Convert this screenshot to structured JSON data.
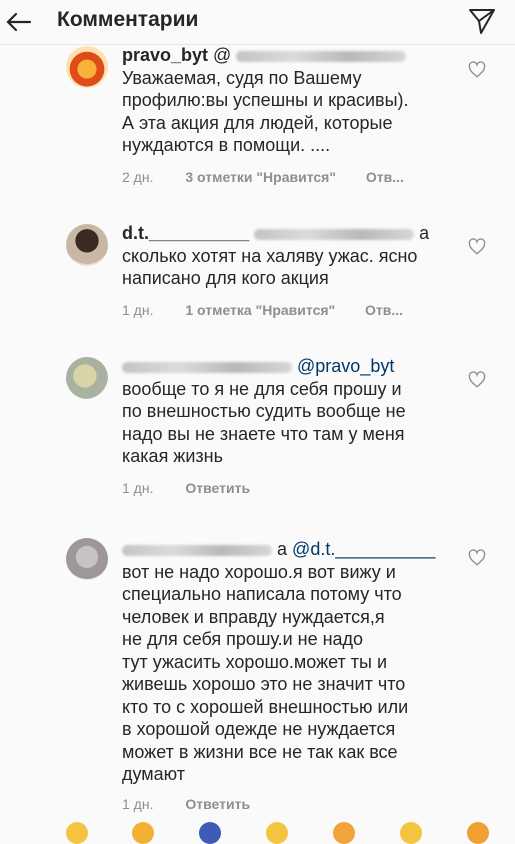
{
  "header": {
    "title": "Комментарии"
  },
  "comments": [
    {
      "username": "pravo_byt",
      "username_suffix": "@",
      "lines": [
        "Уважаемая, судя по Вашему",
        "профилю:вы успешны и красивы).",
        "А эта акция для людей,  которые",
        "нуждаются в помощи. ...."
      ],
      "time": "2 дн.",
      "likes": "3 отметки \"Нравится\"",
      "reply": "Отв..."
    },
    {
      "username": "d.t.__________",
      "username_suffix": "a",
      "lines": [
        "сколько хотят на халяву ужас. ясно",
        "написано для кого акция"
      ],
      "time": "1 дн.",
      "likes": "1 отметка \"Нравится\"",
      "reply": "Отв..."
    },
    {
      "username": "",
      "mention": "@pravo_byt",
      "lines": [
        "вообще то я не для себя прошу и",
        "по внешностью судить вообще не",
        "надо вы не знаете что там у меня",
        "какая жизнь"
      ],
      "time": "1 дн.",
      "reply": "Ответить"
    },
    {
      "username": "",
      "username_suffix": "a",
      "mention": "@d.t.__________",
      "lines": [
        "вот не надо хорошо.я вот вижу и",
        "специально написала потому что",
        "человек и вправду нуждается,я",
        "не для себя прошу.и не надо",
        "тут ужасить хорошо.может ты и",
        "живешь хорошо это не значит что",
        "кто то с хорошей внешностью или",
        "в хорошой одежде не нуждается",
        "может в жизни все не так как все",
        "думают"
      ],
      "time": "1 дн.",
      "reply": "Ответить"
    }
  ],
  "colors": {
    "text": "#262626",
    "meta": "#8e8e8e",
    "mention": "#00376b",
    "background": "#fafafa"
  },
  "icons": [
    "back-arrow-icon",
    "direct-share-icon",
    "heart-outline-icon"
  ]
}
